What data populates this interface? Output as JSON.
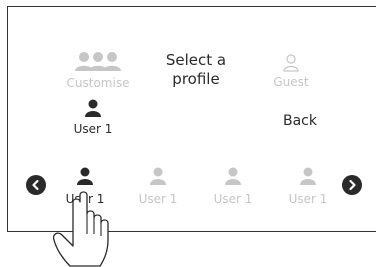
{
  "screen": {
    "title": "Select a profile",
    "customise_label": "Customise",
    "guest_label": "Guest",
    "selected_user_label": "User 1",
    "back_label": "Back"
  },
  "carousel": {
    "items": [
      {
        "label": "User 1",
        "state": "active"
      },
      {
        "label": "User 1",
        "state": "dim"
      },
      {
        "label": "User 1",
        "state": "dim"
      },
      {
        "label": "User 1",
        "state": "dim"
      }
    ]
  },
  "colors": {
    "dark": "#2a2a2a",
    "dim": "#c6c6c6",
    "frame": "#333333",
    "background": "#ffffff"
  },
  "icons": {
    "customise": "group-icon",
    "guest": "user-outline-icon",
    "user": "user-icon",
    "prev": "chevron-left-circle-icon",
    "next": "chevron-right-circle-icon",
    "pointer": "pointing-hand-icon"
  }
}
